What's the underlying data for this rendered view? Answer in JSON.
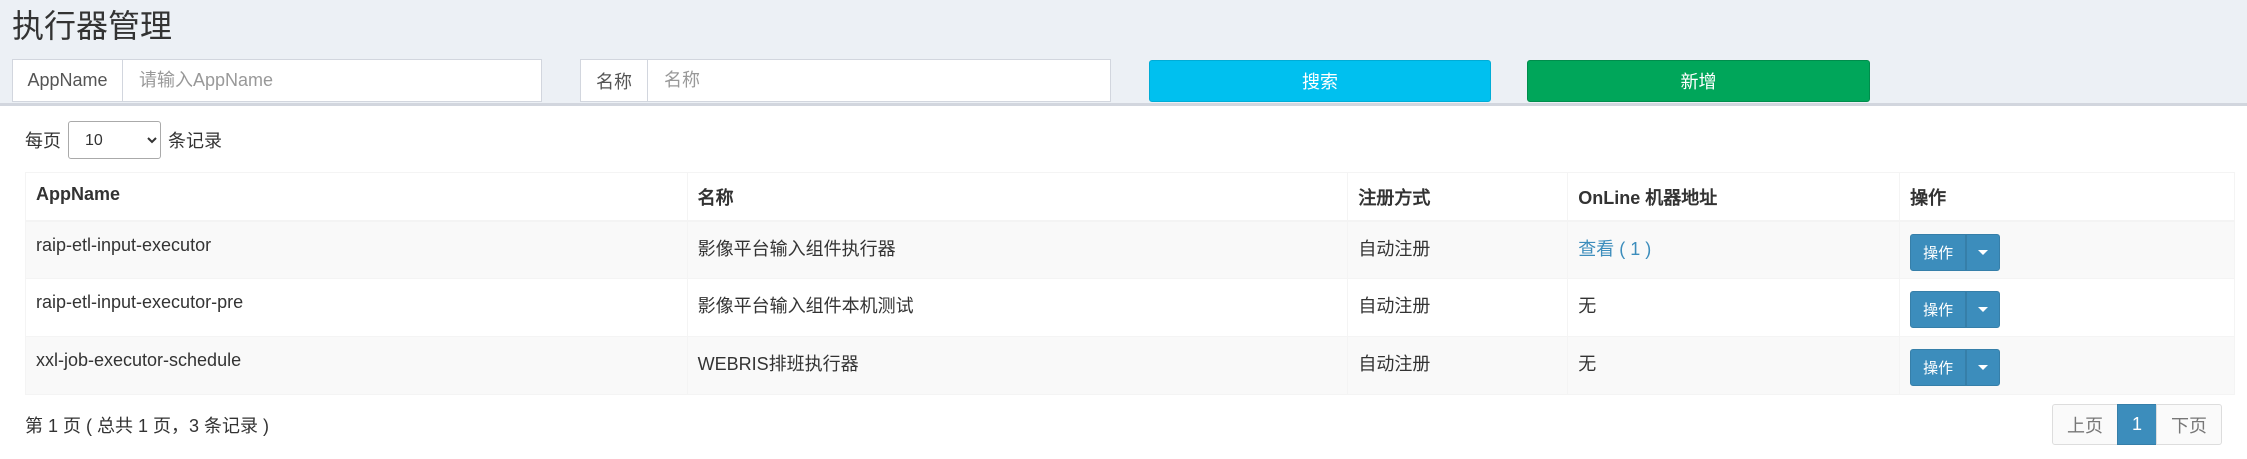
{
  "page": {
    "title": "执行器管理"
  },
  "filters": {
    "appname": {
      "label": "AppName",
      "placeholder": "请输入AppName",
      "value": ""
    },
    "title": {
      "label": "名称",
      "placeholder": "名称",
      "value": ""
    },
    "search_label": "搜索",
    "add_label": "新增"
  },
  "length_menu": {
    "prefix": "每页",
    "selected": "10",
    "suffix": "条记录"
  },
  "table": {
    "columns": [
      "AppName",
      "名称",
      "注册方式",
      "OnLine 机器地址",
      "操作"
    ],
    "rows": [
      {
        "appname": "raip-etl-input-executor",
        "title": "影像平台输入组件执行器",
        "address_type": "自动注册",
        "online": "查看 ( 1 )",
        "online_is_link": true,
        "op_label": "操作"
      },
      {
        "appname": "raip-etl-input-executor-pre",
        "title": "影像平台输入组件本机测试",
        "address_type": "自动注册",
        "online": "无",
        "online_is_link": false,
        "op_label": "操作"
      },
      {
        "appname": "xxl-job-executor-schedule",
        "title": "WEBRIS排班执行器",
        "address_type": "自动注册",
        "online": "无",
        "online_is_link": false,
        "op_label": "操作"
      }
    ]
  },
  "footer": {
    "info": "第 1 页 ( 总共 1 页，3 条记录 )",
    "pagination": {
      "prev": "上页",
      "current": "1",
      "next": "下页"
    }
  },
  "colors": {
    "primary": "#3c8dbc",
    "info": "#00c0ef",
    "success": "#00a65a",
    "background": "#ecf0f5"
  },
  "icons": {
    "op_dropdown": "caret-down-icon"
  }
}
